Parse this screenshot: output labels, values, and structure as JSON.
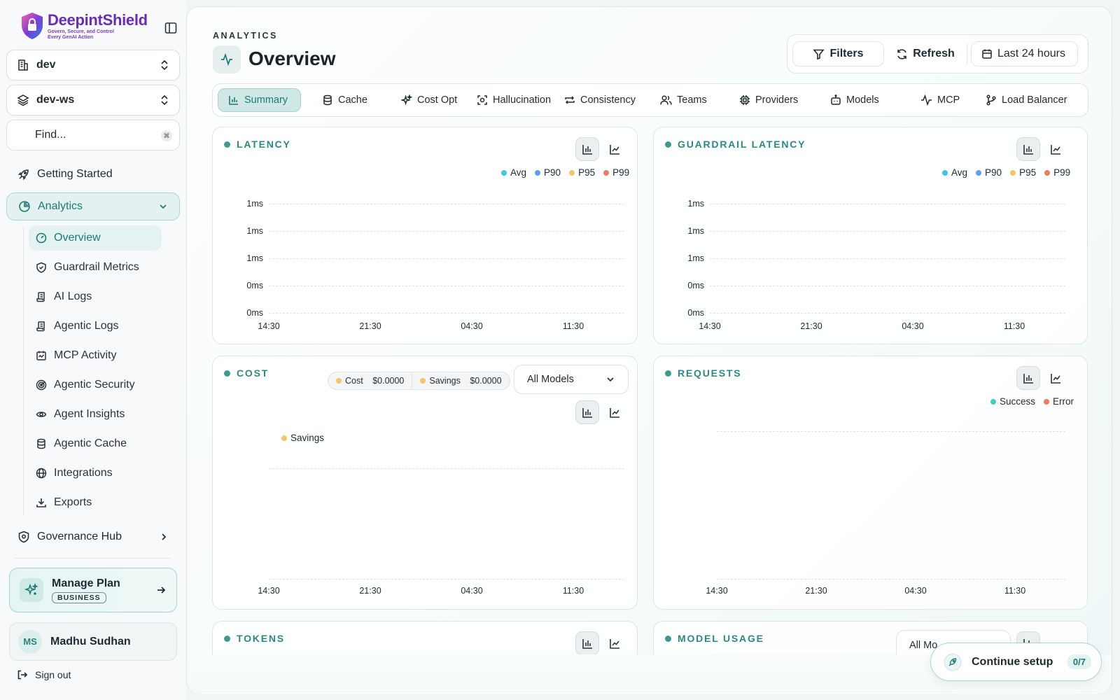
{
  "brand": {
    "name": "DeepintShield",
    "tagline_line1": "Govern, Secure, and Control",
    "tagline_line2": "Every GenAI Action"
  },
  "sidebar": {
    "org_select": "dev",
    "workspace_select": "dev-ws",
    "search_placeholder": "Find...",
    "search_kbd": "⌘",
    "getting_started": "Getting Started",
    "analytics": "Analytics",
    "sub_items": [
      "Overview",
      "Guardrail Metrics",
      "AI Logs",
      "Agentic Logs",
      "MCP Activity",
      "Agentic Security",
      "Agent Insights",
      "Agentic Cache",
      "Integrations",
      "Exports"
    ],
    "governance_hub": "Governance Hub",
    "plan": {
      "title": "Manage Plan",
      "badge": "BUSINESS"
    },
    "user": {
      "initials": "MS",
      "name": "Madhu Sudhan"
    },
    "sign_out": "Sign out"
  },
  "header": {
    "eyebrow": "ANALYTICS",
    "title": "Overview",
    "filters": "Filters",
    "refresh": "Refresh",
    "range": "Last 24 hours"
  },
  "tabs": [
    "Summary",
    "Cache",
    "Cost Opt",
    "Hallucination",
    "Consistency",
    "Teams",
    "Providers",
    "Models",
    "MCP",
    "Load Balancer"
  ],
  "cards": {
    "latency": {
      "title": "LATENCY",
      "legend": [
        "Avg",
        "P90",
        "P95",
        "P99"
      ]
    },
    "guardrail": {
      "title": "GUARDRAIL LATENCY",
      "legend": [
        "Avg",
        "P90",
        "P95",
        "P99"
      ]
    },
    "cost": {
      "title": "COST",
      "cost_label": "Cost",
      "cost_value": "$0.0000",
      "savings_label": "Savings",
      "savings_value": "$0.0000",
      "model_select": "All Models",
      "legend": [
        "Savings"
      ]
    },
    "requests": {
      "title": "REQUESTS",
      "legend": [
        "Success",
        "Error"
      ]
    },
    "tokens": {
      "title": "TOKENS"
    },
    "model_usage": {
      "title": "MODEL USAGE",
      "model_select": "All Mo"
    }
  },
  "colors": {
    "avg": "#3ec8e0",
    "p90": "#5b9ff0",
    "p95": "#f5c46b",
    "p99": "#f07a62",
    "success": "#3ecfbf",
    "error": "#f07a62",
    "savings": "#f5c46b",
    "accent": "#2b8a80"
  },
  "chart_data": [
    {
      "type": "line",
      "title": "LATENCY",
      "series": [
        {
          "name": "Avg",
          "values": []
        },
        {
          "name": "P90",
          "values": []
        },
        {
          "name": "P95",
          "values": []
        },
        {
          "name": "P99",
          "values": []
        }
      ],
      "y_ticks": [
        "1ms",
        "1ms",
        "1ms",
        "0ms",
        "0ms"
      ],
      "x_ticks": [
        "14:30",
        "21:30",
        "04:30",
        "11:30"
      ]
    },
    {
      "type": "line",
      "title": "GUARDRAIL LATENCY",
      "series": [
        {
          "name": "Avg",
          "values": []
        },
        {
          "name": "P90",
          "values": []
        },
        {
          "name": "P95",
          "values": []
        },
        {
          "name": "P99",
          "values": []
        }
      ],
      "y_ticks": [
        "1ms",
        "1ms",
        "1ms",
        "0ms",
        "0ms"
      ],
      "x_ticks": [
        "14:30",
        "21:30",
        "04:30",
        "11:30"
      ]
    },
    {
      "type": "bar",
      "title": "COST",
      "series": [
        {
          "name": "Savings",
          "values": []
        }
      ],
      "x_ticks": [
        "14:30",
        "21:30",
        "04:30",
        "11:30"
      ]
    },
    {
      "type": "bar",
      "title": "REQUESTS",
      "series": [
        {
          "name": "Success",
          "values": []
        },
        {
          "name": "Error",
          "values": []
        }
      ],
      "x_ticks": [
        "14:30",
        "21:30",
        "04:30",
        "11:30"
      ]
    }
  ],
  "setup": {
    "label": "Continue setup",
    "progress": "0/7"
  }
}
